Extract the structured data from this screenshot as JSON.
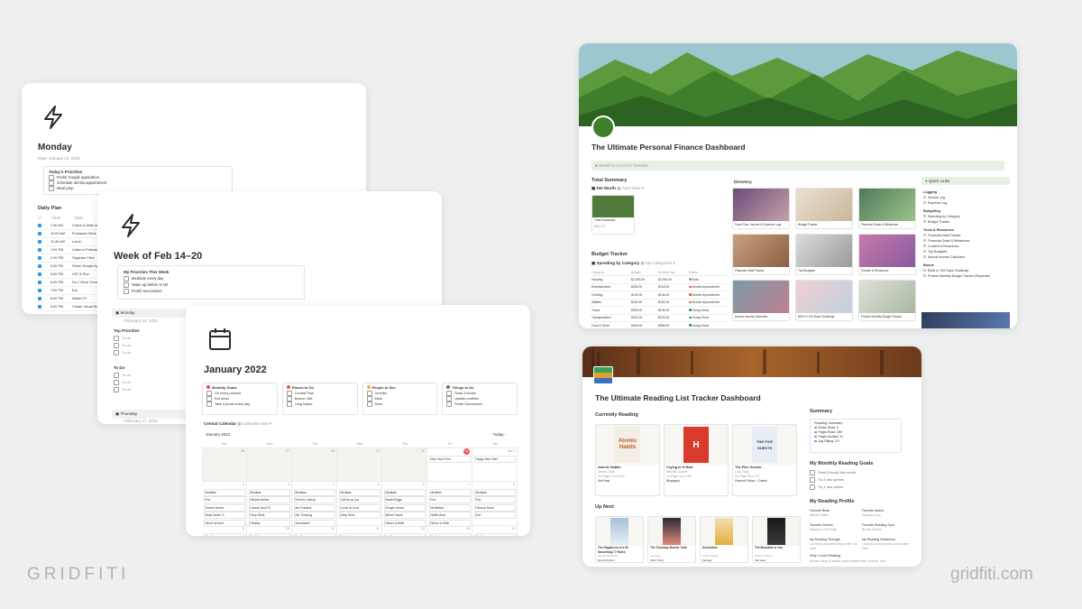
{
  "brand": {
    "left": "GRIDFITI",
    "right": "gridfiti.com"
  },
  "monday": {
    "title": "Monday",
    "date": "Date: January 24, 2022",
    "priorities_title": "Today's Priorities",
    "priorities": [
      "Finish Google application",
      "Schedule dentist appointment",
      "Meal prep"
    ],
    "daily_plan_title": "Daily Plan",
    "col_time": "Time",
    "col_task": "Task",
    "plan": [
      {
        "time": "7:30 AM",
        "task": "Check & Write tasks"
      },
      {
        "time": "10:00 AM",
        "task": "Freelance Work"
      },
      {
        "time": "11:30 AM",
        "task": "Lunch"
      },
      {
        "time": "1:00 PM",
        "task": "Listen to Podcast"
      },
      {
        "time": "2:00 PM",
        "task": "Organize Files"
      },
      {
        "time": "3:00 PM",
        "task": "Finish Google App"
      },
      {
        "time": "5:00 PM",
        "task": "HIIT & Run"
      },
      {
        "time": "6:00 PM",
        "task": "Do 1 Work Chore"
      },
      {
        "time": "7:00 PM",
        "task": "Eat"
      },
      {
        "time": "8:00 PM",
        "task": "Watch TV"
      },
      {
        "time": "9:00 PM",
        "task": "Create Visual Board"
      }
    ]
  },
  "week": {
    "title": "Week of Feb 14–20",
    "priorities_title": "My Priorities This Week",
    "priorities": [
      "Meditate every day",
      "Wake up before 8 AM",
      "Finish Succession"
    ],
    "days": [
      {
        "name": "Monday",
        "date": "February 14, 2022"
      },
      {
        "name": "Thursday",
        "date": "February 17, 2022"
      }
    ],
    "top_priorities": "Top Priorities",
    "todo": "To Do",
    "todo_items": [
      "To-do",
      "To-do",
      "To-do"
    ]
  },
  "january": {
    "title": "January 2022",
    "boxes": [
      {
        "title": "Monthly Goals",
        "items": [
          "Go every present",
          "Eat clean",
          "Take a photo every day"
        ],
        "icon": "goal"
      },
      {
        "title": "Places to Go",
        "items": [
          "Central Park",
          "Boston, MA",
          "Long Island"
        ],
        "icon": "pin"
      },
      {
        "title": "People to See",
        "items": [
          "Jennifer",
          "Mark",
          "Mom"
        ],
        "icon": "smile"
      },
      {
        "title": "Things to Do",
        "items": [
          "Read 3 books",
          "Update portfolio",
          "Finish Succession"
        ],
        "icon": "list"
      }
    ],
    "calendar_title": "Central Calendar",
    "calendar_view": "Calendar view",
    "month_label": "January 2022",
    "today": "Today",
    "weekdays": [
      "Sun",
      "Mon",
      "Tue",
      "Wed",
      "Thu",
      "Fri",
      "Sat"
    ],
    "row1_nums": [
      "26",
      "27",
      "28",
      "29",
      "30",
      "31",
      "Jan 1"
    ],
    "row2_nums": [
      "2",
      "3",
      "4",
      "5",
      "6",
      "7",
      "8"
    ],
    "row3_nums": [
      "9",
      "10",
      "11",
      "12",
      "13",
      "14",
      "15"
    ],
    "row1_events": {
      "fri": "New Year's Eve",
      "sat": "Happy New Year!"
    },
    "row2_events": [
      [
        "Meditate",
        "Run",
        "Games Marker",
        "Read Invest. G",
        "Dinner at Aunt"
      ],
      [
        "Meditate",
        "Studied Adobe",
        "Unread Hard Tu",
        "Deep Work",
        "Healthy"
      ],
      [
        "Meditate",
        "French Looking",
        "Ate Fearless",
        "Ate Throwing",
        "Succession"
      ],
      [
        "Meditate",
        "Call for up Lay",
        "Lunch at Luna",
        "Deep Work",
        ""
      ],
      [
        "Meditate",
        "Booted Eggs",
        "Google Versat",
        "Where Faces",
        "Dinner & Write"
      ],
      [
        "Meditate",
        "Run",
        "Meditation",
        "Netflix Bizm",
        "Dinner & Write"
      ],
      [
        "Meditate",
        "Run",
        "Famous Mode",
        "Run",
        ""
      ]
    ],
    "row3_first": "Meditate"
  },
  "finance": {
    "title": "The Ultimate Personal Finance Dashboard",
    "callout": "Wealth is a tool for freedom",
    "total_summary": "Total Summary",
    "net_worth_tab": "Net Worth",
    "card_view": "Card View",
    "total_label": "Total Summary",
    "total_value": "$89,475",
    "budget_tracker": "Budget Tracker",
    "spending_tab": "Spending by Category",
    "my_categories": "My Categories",
    "budget_cols": [
      "Category",
      "Budget",
      "Monthly Avg",
      "Status"
    ],
    "budget_rows": [
      {
        "cat": "Housing",
        "budget": "$2,000.00",
        "avg": "$2,000.00",
        "status": "Even"
      },
      {
        "cat": "Entertainment",
        "budget": "$200.00",
        "avg": "$218.00",
        "status": "Needs Improvement"
      },
      {
        "cat": "Clothing",
        "budget": "$120.00",
        "avg": "$146.00",
        "status": "Needs Improvement"
      },
      {
        "cat": "Utilities",
        "budget": "$150.00",
        "avg": "$152.00",
        "status": "Needs Improvement"
      },
      {
        "cat": "Travel",
        "budget": "$300.00",
        "avg": "$130.00",
        "status": "Going Great"
      },
      {
        "cat": "Transportation",
        "budget": "$150.00",
        "avg": "$120.00",
        "status": "Going Great"
      },
      {
        "cat": "Food & Drink",
        "budget": "$400.00",
        "avg": "$355.00",
        "status": "Going Great"
      }
    ],
    "directory": "Directory",
    "dir_items": [
      "Cash Flow: Income & Expense Logs",
      "Budget Tracker",
      "Financial Goals & Milestones",
      "Financial Habit Tracker",
      "Trip Budgeter",
      "Content & Resources",
      "Annual Income Calculator",
      "$10K in 100 Days Challenge",
      "Precise Monthly Budget Tracker"
    ],
    "quick_links": "Quick Links",
    "logging": "Logging",
    "logging_items": [
      "Income Log",
      "Expense Log"
    ],
    "budgeting": "Budgeting",
    "budgeting_items": [
      "Spending by Category",
      "Budget Tracker"
    ],
    "tools": "Tools & Resources",
    "tools_items": [
      "Financial Habit Tracker",
      "Financial Goals & Milestones",
      "Content & Resources",
      "Trip Budgeter",
      "Annual Income Calculator"
    ],
    "bonus": "Bonus",
    "bonus_items": [
      "$10K in 100 Days Challenge",
      "Precise Monthly Budget Tracker (Separate)"
    ]
  },
  "reading": {
    "title": "The Ultimate Reading List Tracker Dashboard",
    "currently": "Currently Reading",
    "current_books": [
      {
        "title": "Atomic Habits",
        "author": "James Clear",
        "pages": "On Page 175 of 320",
        "status": "Self Help",
        "cover_text": "Atomic Habits"
      },
      {
        "title": "Crying in H Mart",
        "author": "Michelle Zauner",
        "pages": "On Page 43 of 256",
        "status": "Biography",
        "cover_text": "H"
      },
      {
        "title": "The Five Guests",
        "author": "Lucy Foley",
        "pages": "On Page 63 of 371",
        "status": "General Fiction · Chanel",
        "cover_text": "THE FIVE GUESTS"
      }
    ],
    "summary": "Summary",
    "summary_box_title": "Reading Summary",
    "summary_items": [
      "Books Read: 5",
      "Pages Read: 289",
      "Pages Audited: 31",
      "Avg Rating: 4.5"
    ],
    "goals": "My Monthly Reading Goals",
    "goal_items": [
      "Read 5 books this month",
      "Try 3 new genres",
      "Try 1 new author"
    ],
    "profile": "My Reading Profile",
    "profile_items": [
      {
        "k": "Favorite Book",
        "v": "Atomic Habits"
      },
      {
        "k": "Favorite Author",
        "v": "Stephen King"
      },
      {
        "k": "Favorite Genres",
        "v": "Mystery & Self Help"
      },
      {
        "k": "Favorite Reading Spot",
        "v": "By the window"
      },
      {
        "k": "My Reading Strength",
        "v": "Currently consistent blog writer I've read"
      },
      {
        "k": "My Reading Weakness",
        "v": "I read too many books at the same time"
      }
    ],
    "why": "Why I Love Reading",
    "why_text": "Books carry a whole world within their covers, one",
    "up_next": "Up Next",
    "next_books": [
      {
        "title": "The Happiness of a 50 Something 77 Rules",
        "author": "Alexandra Potter",
        "genre": "Humor/Fiction"
      },
      {
        "title": "The Thursday Murder Club",
        "author": "Lily King",
        "genre": "Short Story"
      },
      {
        "title": "Dreamland",
        "author": "Heidi Chaves",
        "genre": "Fantasy"
      },
      {
        "title": "The Mountain is You",
        "author": "Brianna Wiest",
        "genre": "Self Help"
      }
    ]
  }
}
